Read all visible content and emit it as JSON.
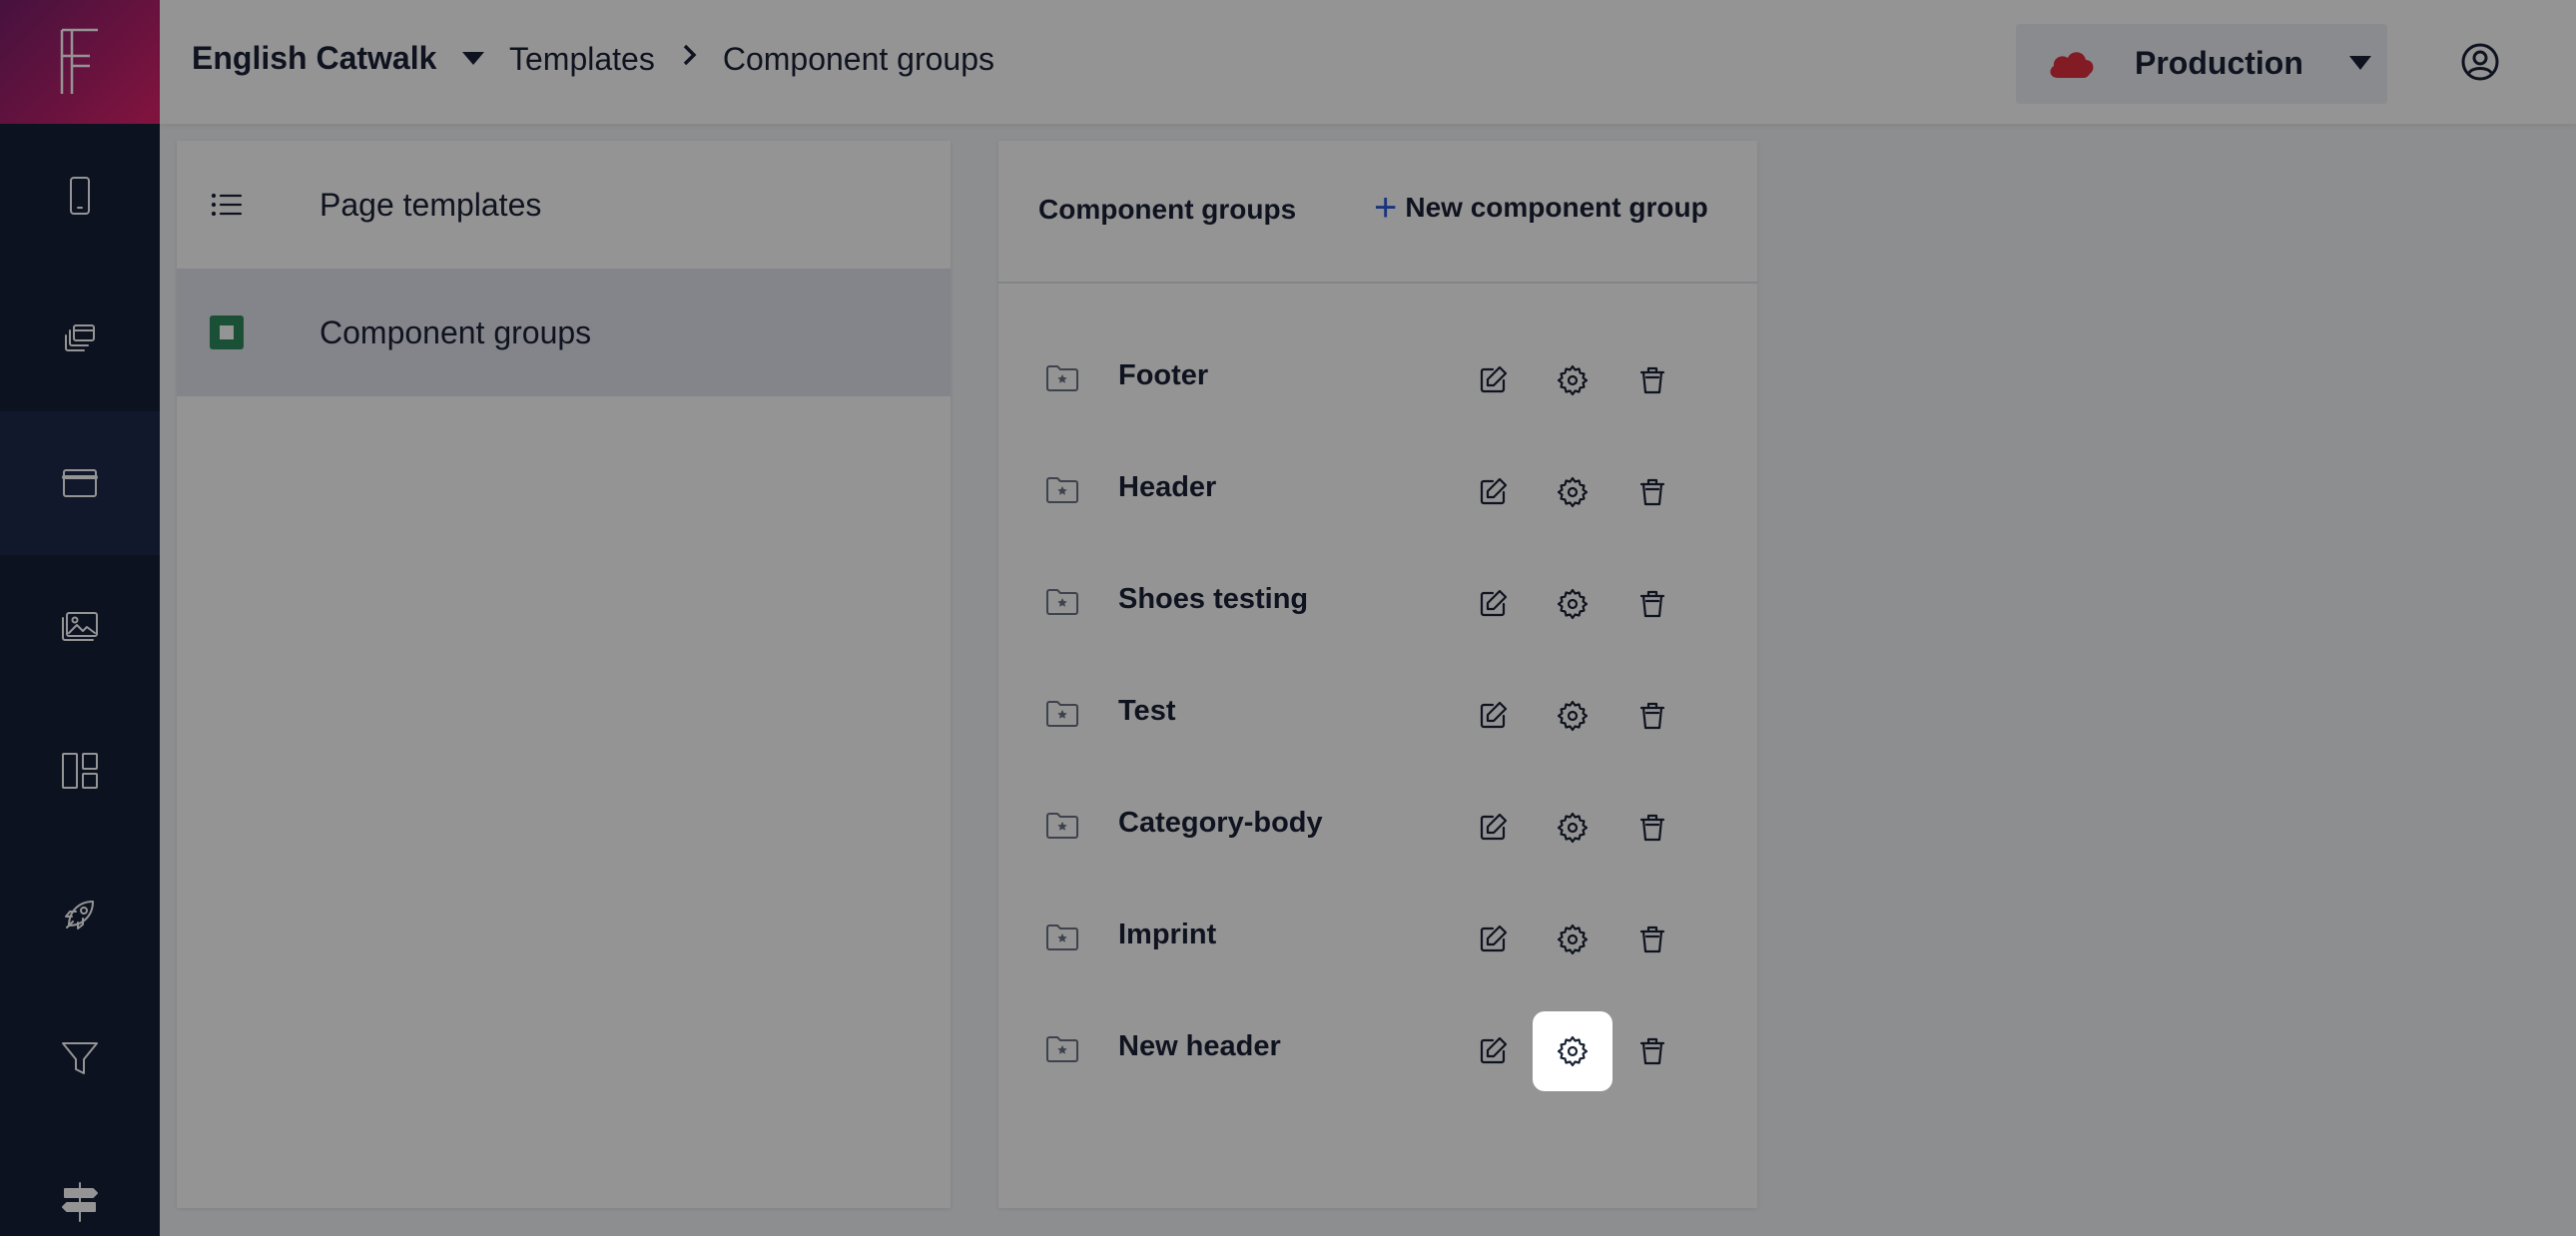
{
  "app": {
    "logo_letter": "F"
  },
  "header": {
    "site_name": "English Catwalk",
    "breadcrumb": [
      "Templates",
      "Component groups"
    ],
    "environment": "Production"
  },
  "sidebar": {
    "icons": [
      "mobile-icon",
      "pages-icon",
      "browser-window-icon",
      "media-gallery-icon",
      "dashboard-layout-icon",
      "rocket-icon",
      "filter-icon",
      "signpost-icon"
    ],
    "active_index": 2
  },
  "templates_nav": {
    "items": [
      {
        "label": "Page templates",
        "icon": "list-icon"
      },
      {
        "label": "Component groups",
        "icon": "green-square-icon",
        "selected": true
      }
    ]
  },
  "component_groups": {
    "title": "Component groups",
    "new_button_label": "New component group",
    "items": [
      {
        "name": "Footer"
      },
      {
        "name": "Header"
      },
      {
        "name": "Shoes testing"
      },
      {
        "name": "Test"
      },
      {
        "name": "Category-body"
      },
      {
        "name": "Imprint"
      },
      {
        "name": "New header"
      }
    ]
  },
  "colors": {
    "rail_bg": "#162038",
    "logo_gradient_start": "#7a1e6b",
    "logo_gradient_end": "#e0226c",
    "accent_blue": "#2a5bd7",
    "cloud_red": "#e0303f",
    "component_groups_icon_green": "#2e8a5c"
  }
}
